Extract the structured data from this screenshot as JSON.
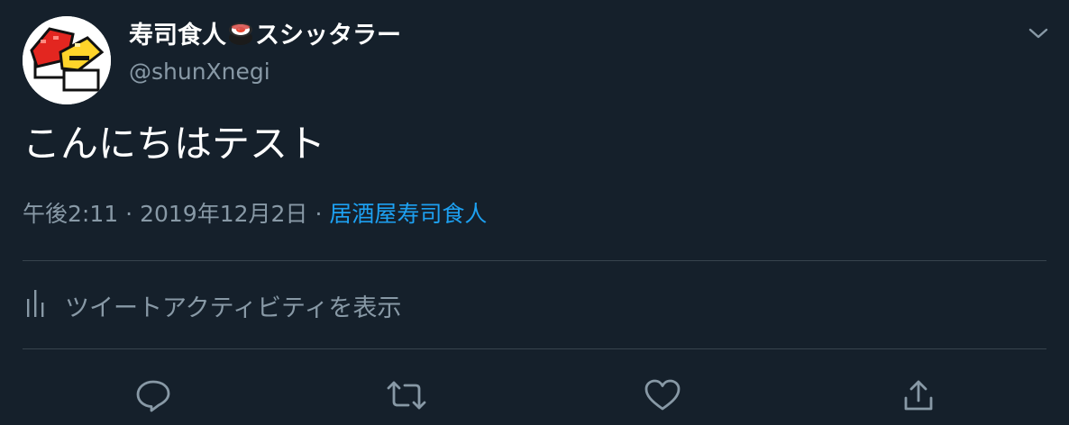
{
  "tweet": {
    "display_name_before": "寿司食人",
    "display_name_after": "スシッタラー",
    "emoji": "sushi-icon",
    "handle": "@shunXnegi",
    "text": "こんにちはテスト",
    "time": "午後2:11",
    "date": "2019年12月2日",
    "source": "居酒屋寿司食人",
    "meta_separator": "·"
  },
  "activity": {
    "label": "ツイートアクティビティを表示",
    "icon": "bar-chart-icon"
  },
  "actions": {
    "items": [
      "reply-icon",
      "retweet-icon",
      "like-icon",
      "share-icon"
    ]
  },
  "colors": {
    "background": "#15202b",
    "text_primary": "#ffffff",
    "text_secondary": "#8899a6",
    "accent": "#1da1f2",
    "divider": "#38444d"
  }
}
